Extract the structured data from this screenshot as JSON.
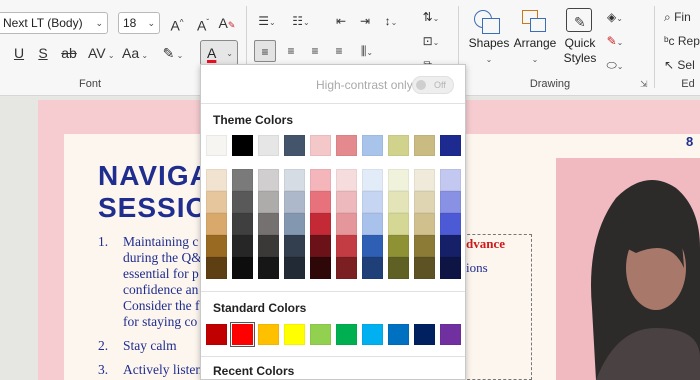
{
  "ribbon": {
    "font_name": "Next LT (Body)",
    "font_size": "18",
    "group_font_label": "Font",
    "group_drawing_label": "Drawing",
    "group_editing_label": "Ed",
    "shapes_label": "Shapes",
    "arrange_label": "Arrange",
    "quick_label": "Quick",
    "styles_label": "Styles",
    "find_label": "Fin",
    "replace_label": "Rep",
    "select_label": "Sel",
    "font_color_letter": "A",
    "font_color_hex": "#e81123",
    "bold_glyph_u": "U",
    "strike_glyph": "S",
    "ab_glyph": "ab",
    "av_glyph": "AV",
    "aa_glyph": "Aa"
  },
  "popup": {
    "high_contrast_label": "High-contrast only",
    "toggle_label": "Off",
    "theme_title": "Theme Colors",
    "standard_title": "Standard Colors",
    "recent_title": "Recent Colors",
    "theme_top": [
      "#f7f5f2",
      "#000000",
      "#e7e6e6",
      "#44546a",
      "#f4c7c9",
      "#e48a8e",
      "#a9c4eb",
      "#d1d38d",
      "#c9bb81",
      "#1d2a8f"
    ],
    "theme_shades": [
      [
        "#f1e3cf",
        "#e6c79d",
        "#d8a96a",
        "#996a22",
        "#5e3f13"
      ],
      [
        "#7a7a7a",
        "#595959",
        "#3f3f3f",
        "#262626",
        "#0d0d0d"
      ],
      [
        "#d0cece",
        "#aeabab",
        "#767171",
        "#3b3838",
        "#171616"
      ],
      [
        "#d6dce4",
        "#adb9ca",
        "#8497b0",
        "#333f4f",
        "#222a35"
      ],
      [
        "#f4b6bb",
        "#e8727b",
        "#c42a35",
        "#6b1219",
        "#2e0709"
      ],
      [
        "#f6dcdd",
        "#eeb9bc",
        "#e4969a",
        "#c43c43",
        "#7b1f23"
      ],
      [
        "#e2ebf8",
        "#c6d6f2",
        "#a9c2eb",
        "#2f5fb4",
        "#1f3f78"
      ],
      [
        "#f1f2dc",
        "#e3e5b9",
        "#d5d795",
        "#8e9235",
        "#5e6123"
      ],
      [
        "#efead9",
        "#dfd5b3",
        "#d0c08d",
        "#8c7b36",
        "#5d5224"
      ],
      [
        "#c3c8f1",
        "#8891e3",
        "#4c5ad6",
        "#162069",
        "#0e1545"
      ]
    ],
    "standard": [
      "#c00000",
      "#ff0000",
      "#ffc000",
      "#ffff00",
      "#92d050",
      "#00b050",
      "#00b0f0",
      "#0070c0",
      "#002060",
      "#7030a0"
    ]
  },
  "slide": {
    "title_line1": "NAVIGA",
    "title_line2": "SESSIO",
    "items": [
      {
        "num": "1.",
        "lines": [
          "Maintaining c",
          "during the Q&",
          "essential for p",
          "confidence an",
          "Consider the f",
          "for staying co"
        ]
      },
      {
        "num": "2.",
        "lines": [
          "Stay calm"
        ]
      },
      {
        "num": "3.",
        "lines": [
          "Actively listen"
        ]
      }
    ],
    "advance_text": "dvance",
    "ions_text": "ions",
    "page_number": "8"
  }
}
